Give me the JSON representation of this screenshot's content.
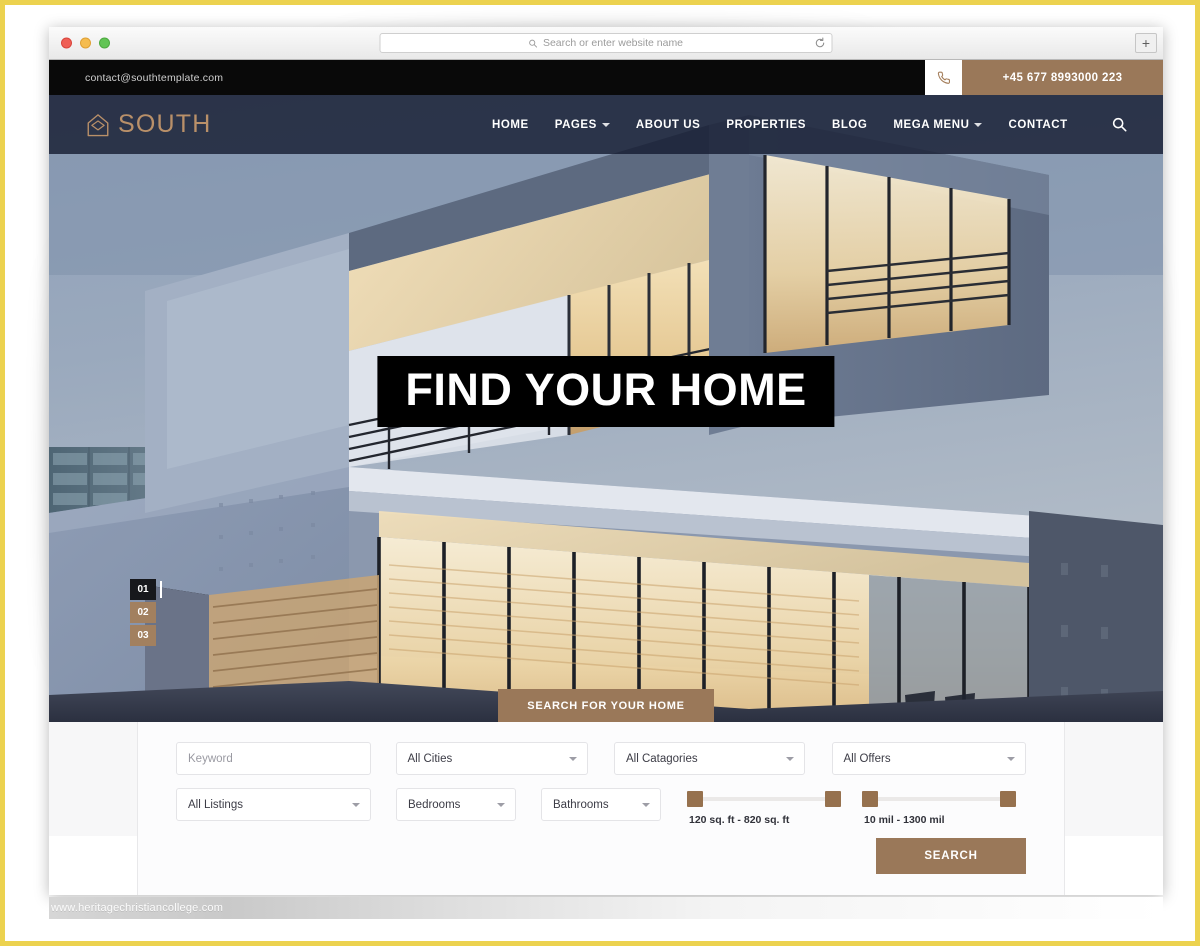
{
  "browser": {
    "traffic_lights": [
      "close",
      "minimize",
      "maximize"
    ],
    "address_placeholder": "Search or enter website name",
    "reload_icon": "reload-icon",
    "search_icon": "search-icon",
    "new_tab_label": "+"
  },
  "topbar": {
    "email": "contact@southtemplate.com",
    "phone_icon": "phone-icon",
    "phone": "+45 677 8993000 223"
  },
  "nav": {
    "brand": "SOUTH",
    "brand_icon": "home-outline-icon",
    "search_icon": "search-icon",
    "items": [
      {
        "label": "HOME",
        "caret": false
      },
      {
        "label": "PAGES",
        "caret": true
      },
      {
        "label": "ABOUT US",
        "caret": false
      },
      {
        "label": "PROPERTIES",
        "caret": false
      },
      {
        "label": "BLOG",
        "caret": false
      },
      {
        "label": "MEGA MENU",
        "caret": true
      },
      {
        "label": "CONTACT",
        "caret": false
      }
    ]
  },
  "hero": {
    "title": "FIND YOUR HOME",
    "cta": "SEARCH FOR YOUR HOME",
    "slides": [
      {
        "num": "01",
        "state": "active"
      },
      {
        "num": "02",
        "state": "idle"
      },
      {
        "num": "03",
        "state": "idle"
      }
    ]
  },
  "search_form": {
    "keyword_placeholder": "Keyword",
    "keyword_value": "",
    "cities": "All Cities",
    "categories": "All Catagories",
    "offers": "All Offers",
    "listings": "All Listings",
    "bedrooms": "Bedrooms",
    "bathrooms": "Bathrooms",
    "area_range": "120 sq. ft - 820 sq. ft",
    "price_range": "10 mil - 1300 mil",
    "submit": "SEARCH"
  },
  "watermark": "www.heritagechristiancollege.com",
  "colors": {
    "accent_brown": "#9a7859",
    "brand_tan": "#b99069",
    "topbar_black": "#090909",
    "nav_navy": "#141a30",
    "frame_yellow": "#ecd24f",
    "slider_handle": "#96714e"
  }
}
